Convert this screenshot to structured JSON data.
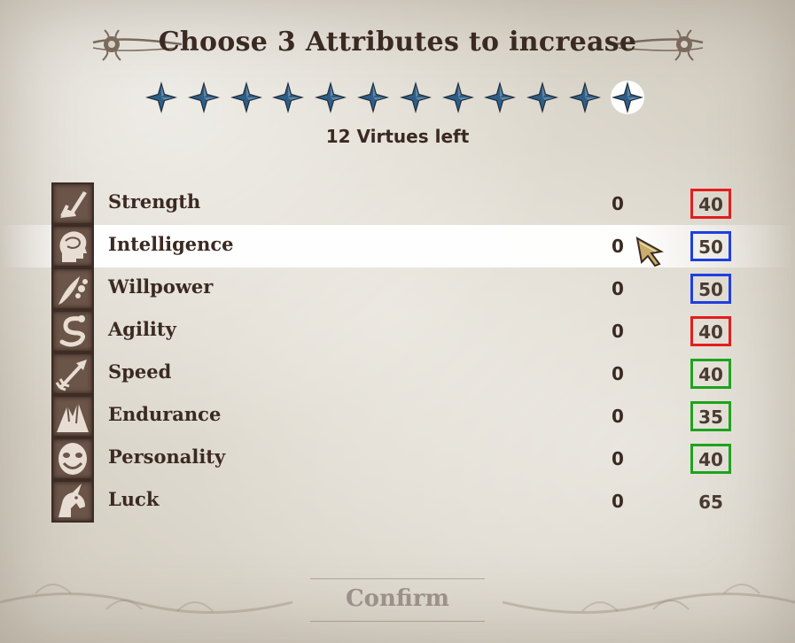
{
  "title": "Choose 3 Attributes to increase",
  "virtues_left": "12 Virtues left",
  "virtues": {
    "total": 12,
    "remaining": 12,
    "highlighted_index": 11,
    "color": "#2e5d86"
  },
  "attributes": [
    {
      "name": "Strength",
      "increase": "0",
      "value": "40",
      "icon": "sword-arm-icon",
      "border_color": "#e31e1e"
    },
    {
      "name": "Intelligence",
      "increase": "0",
      "value": "50",
      "icon": "brain-head-icon",
      "border_color": "#1f3fe0",
      "selected": true
    },
    {
      "name": "Willpower",
      "increase": "0",
      "value": "50",
      "icon": "quill-orb-icon",
      "border_color": "#1f3fe0"
    },
    {
      "name": "Agility",
      "increase": "0",
      "value": "40",
      "icon": "serpent-icon",
      "border_color": "#e31e1e"
    },
    {
      "name": "Speed",
      "increase": "0",
      "value": "40",
      "icon": "arrow-icon",
      "border_color": "#1ea31e"
    },
    {
      "name": "Endurance",
      "increase": "0",
      "value": "35",
      "icon": "mountain-icon",
      "border_color": "#1ea31e"
    },
    {
      "name": "Personality",
      "increase": "0",
      "value": "40",
      "icon": "mask-icon",
      "border_color": "#1ea31e"
    },
    {
      "name": "Luck",
      "increase": "0",
      "value": "65",
      "icon": "unicorn-icon",
      "border_color": ""
    }
  ],
  "confirm_label": "Confirm",
  "colors": {
    "text": "#3b2a22",
    "confirm_disabled": "#9b918a",
    "highlight_row": "#ffffff"
  }
}
